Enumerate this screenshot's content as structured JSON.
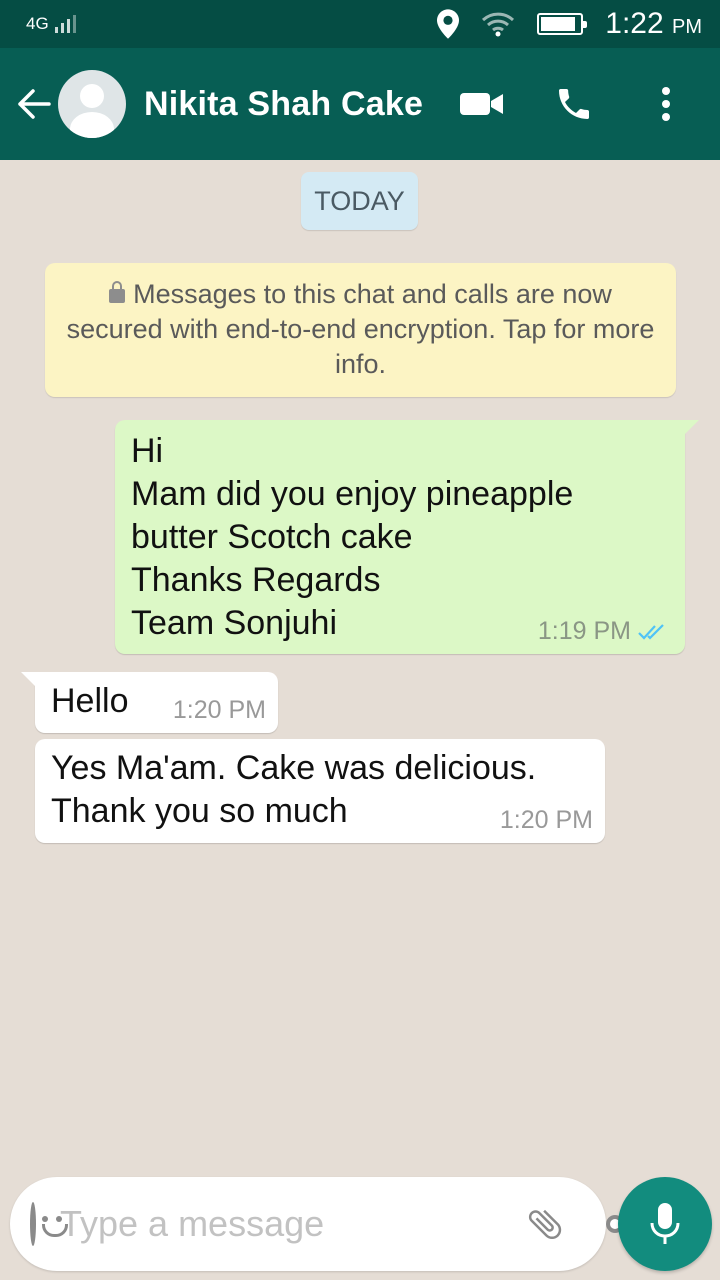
{
  "status_bar": {
    "network": "4G",
    "time": "1:22",
    "ampm": "PM",
    "icons": [
      "signal-icon",
      "location-icon",
      "wifi-icon",
      "battery-icon"
    ]
  },
  "header": {
    "contact_name": "Nikita Shah Cake",
    "icons": [
      "back-arrow-icon",
      "avatar-icon",
      "video-call-icon",
      "phone-icon",
      "more-vert-icon"
    ]
  },
  "chat": {
    "date_chip": "TODAY",
    "encryption_notice": "Messages to this chat and calls are now secured with end-to-end encryption. Tap for more info.",
    "messages": [
      {
        "direction": "outgoing",
        "text": "Hi\nMam did you enjoy pineapple\nbutter Scotch cake\nThanks Regards\nTeam Sonjuhi",
        "time": "1:19 PM",
        "status": "read"
      },
      {
        "direction": "incoming",
        "text": "Hello",
        "time": "1:20 PM"
      },
      {
        "direction": "incoming",
        "text": "Yes Ma'am. Cake was delicious.\nThank you so much",
        "time": "1:20 PM"
      }
    ]
  },
  "composer": {
    "placeholder": "Type a message",
    "value": "",
    "icons": [
      "emoji-icon",
      "attach-icon",
      "camera-icon",
      "mic-icon"
    ]
  },
  "colors": {
    "status_bar": "#054d44",
    "app_bar": "#075e54",
    "outgoing_bubble": "#dcf8c6",
    "incoming_bubble": "#ffffff",
    "accent": "#128c7e",
    "read_ticks": "#4fc3f7",
    "chat_background": "#e5ddd5"
  }
}
